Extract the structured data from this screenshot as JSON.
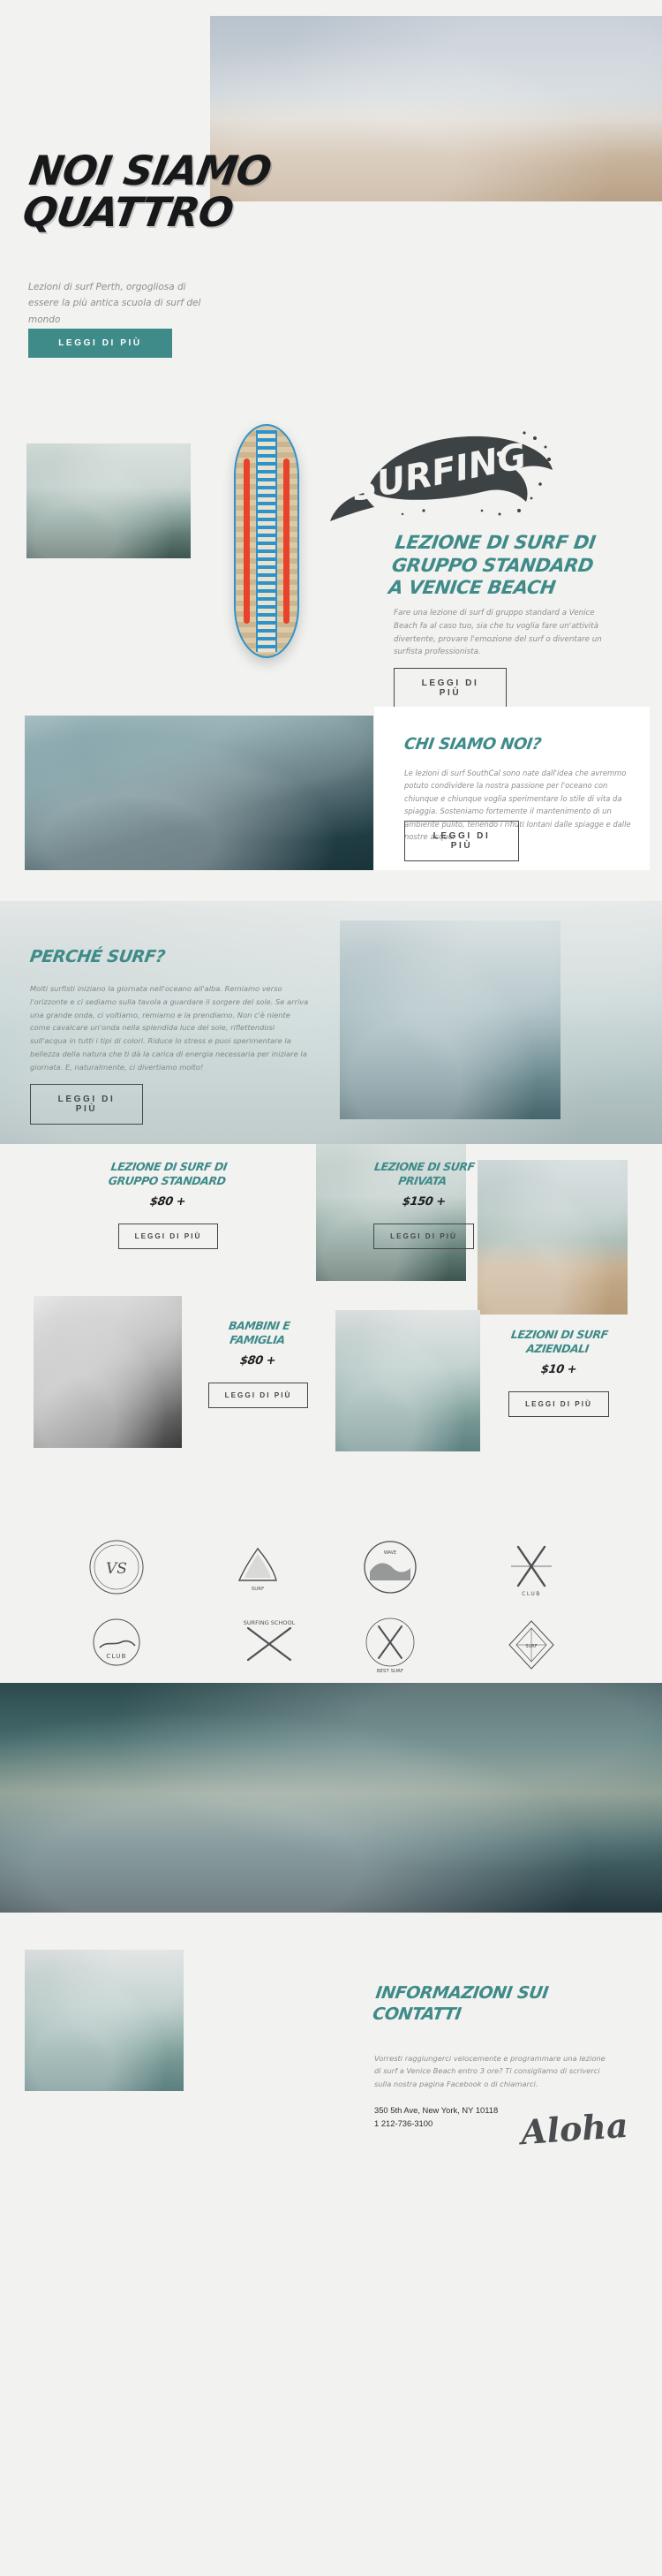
{
  "theme": {
    "accent": "#3f8b89",
    "bg": "#f2f2f0",
    "ink": "#16181a",
    "muted": "#8d9089"
  },
  "hero": {
    "title": "NOI SIAMO\nQUATTRO",
    "subtitle": "Lezioni di surf Perth, orgogliosa di essere la più antica scuola di surf del mondo",
    "cta": "LEGGI DI PIÙ",
    "image_alt": "surfer-on-beach-photo"
  },
  "surfing": {
    "badge_word": "SURFING",
    "title": "LEZIONE DI SURF DI\nGRUPPO STANDARD\nA VENICE BEACH",
    "body": "Fare una lezione di surf di gruppo standard a Venice Beach fa al caso tuo, sia che tu voglia fare un'attività divertente, provare l'emozione del surf o diventare un surfista professionista.",
    "cta": "LEGGI DI PIÙ",
    "surfboard_alt": "decorated-surfboard-illustration",
    "image_alt": "surfer-at-sunset-photo"
  },
  "about": {
    "title": "CHI SIAMO NOI?",
    "body": "Le lezioni di surf SouthCal sono nate dall'idea che avremmo potuto condividere la nostra passione per l'oceano con chiunque e chiunque voglia sperimentare lo stile di vita da spiaggia. Sosteniamo fortemente il mantenimento di un ambiente pulito, tenendo i rifiuti lontani dalle spiagge e dalle nostre acque.",
    "cta": "LEGGI DI PIÙ",
    "image_alt": "big-wave-surfer-photo"
  },
  "why": {
    "title": "PERCHÉ SURF?",
    "body": "Molti surfisti iniziano la giornata nell'oceano all'alba. Remiamo verso l'orizzonte e ci sediamo sulla tavola a guardare il sorgere del sole. Se arriva una grande onda, ci voltiamo, remiamo e la prendiamo. Non c'è niente come cavalcare un'onda nella splendida luce del sole, riflettendosi sull'acqua in tutti i tipi di colori. Riduce lo stress e puoi sperimentare la bellezza della natura che ti dà la carica di energia necessaria per iniziare la giornata. E, naturalmente, ci divertiamo molto!",
    "cta": "LEGGI DI PIÙ",
    "image_alt": "surfer-spray-action-photo"
  },
  "pricing": {
    "cards": [
      {
        "title": "LEZIONE DI SURF DI\nGRUPPO STANDARD",
        "price": "$80 +",
        "cta": "LEGGI DI PIÙ",
        "image_alt": "surfer-sunset-water-photo"
      },
      {
        "title": "LEZIONE DI SURF\nPRIVATA",
        "price": "$150 +",
        "cta": "LEGGI DI PIÙ",
        "image_alt": "two-surfers-beach-photo"
      },
      {
        "title": "BAMBINI E\nFAMIGLIA",
        "price": "$80 +",
        "cta": "LEGGI DI PIÙ",
        "image_alt": "black-white-surfer-photo"
      },
      {
        "title": "LEZIONI DI SURF\nAZIENDALI",
        "price": "$10 +",
        "cta": "LEGGI DI PIÙ",
        "image_alt": "surfer-riding-wave-photo"
      }
    ]
  },
  "logos": {
    "items": [
      {
        "name": "monogram-vs-badge",
        "caption": "VS"
      },
      {
        "name": "shark-fin-badge",
        "caption": "SURF"
      },
      {
        "name": "wave-circle-badge",
        "caption": "WAVE"
      },
      {
        "name": "club-crossed-boards-badge",
        "caption": "CLUB"
      },
      {
        "name": "surf-club-badge",
        "caption": "CLUB"
      },
      {
        "name": "surfing-school-badge",
        "caption": "SURFING SCHOOL"
      },
      {
        "name": "best-surf-badge",
        "caption": "BEST SURF"
      },
      {
        "name": "geometric-diamond-badge",
        "caption": "SURF"
      }
    ]
  },
  "aerial": {
    "image_alt": "aerial-coastline-rocks-photo"
  },
  "contact": {
    "title": "INFORMAZIONI SUI\nCONTATTI",
    "body": "Vorresti raggiungerci velocemente e programmare una lezione di surf a Venice Beach entro 3 ore? Ti consigliamo di scriverci sulla nostra pagina Facebook o di chiamarci.",
    "address": "350 5th Ave, New York, NY 10118",
    "phone": "1 212-736-3100",
    "signature": "Aloha",
    "image_alt": "surfer-carrying-board-photo"
  }
}
